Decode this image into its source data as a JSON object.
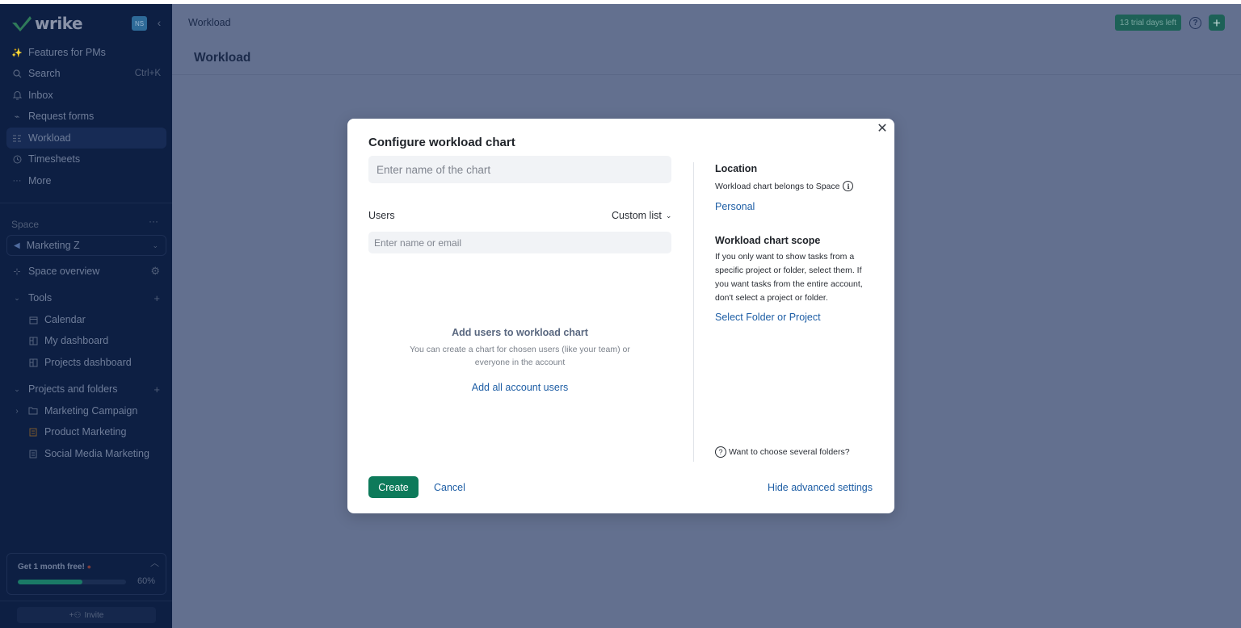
{
  "brand": {
    "name": "wrike",
    "avatar_initials": "NS"
  },
  "sidebar": {
    "nav": [
      {
        "label": "Features for PMs",
        "icon": "sparkle-icon"
      },
      {
        "label": "Search",
        "icon": "search-icon",
        "shortcut": "Ctrl+K"
      },
      {
        "label": "Inbox",
        "icon": "bell-icon"
      },
      {
        "label": "Request forms",
        "icon": "form-icon"
      },
      {
        "label": "Workload",
        "icon": "workload-icon",
        "active": true
      },
      {
        "label": "Timesheets",
        "icon": "clock-icon"
      },
      {
        "label": "More",
        "icon": "more-icon"
      }
    ],
    "space": {
      "label": "Space",
      "more": "···",
      "selected": "Marketing Z",
      "overview": "Space overview"
    },
    "tools": {
      "label": "Tools",
      "items": [
        {
          "label": "Calendar",
          "icon": "calendar-icon"
        },
        {
          "label": "My dashboard",
          "icon": "dashboard-icon"
        },
        {
          "label": "Projects dashboard",
          "icon": "dashboard-icon"
        }
      ]
    },
    "projects": {
      "label": "Projects and folders",
      "items": [
        {
          "label": "Marketing Campaign",
          "icon": "folder-icon"
        },
        {
          "label": "Product Marketing",
          "icon": "project-icon"
        },
        {
          "label": "Social Media Marketing",
          "icon": "project-icon"
        }
      ]
    },
    "promo": {
      "text": "Get 1 month free!",
      "progress": 60,
      "progress_label": "60%"
    },
    "invite": "Invite"
  },
  "header": {
    "breadcrumb": "Workload",
    "trial": "13 trial days left",
    "title": "Workload"
  },
  "modal": {
    "title": "Configure workload chart",
    "name_placeholder": "Enter name of the chart",
    "users_label": "Users",
    "users_mode": "Custom list",
    "email_placeholder": "Enter name or email",
    "empty_title": "Add users to workload chart",
    "empty_desc": "You can create a chart for chosen users (like your team) or everyone in the account",
    "add_all": "Add all account users",
    "location_title": "Location",
    "location_desc": "Workload chart belongs to Space",
    "location_value": "Personal",
    "scope_title": "Workload chart scope",
    "scope_desc": "If you only want to show tasks from a specific project or folder, select them. If you want tasks from the entire account, don't select a project or folder.",
    "select_folder": "Select Folder or Project",
    "several_folders": "Want to choose several folders?",
    "create": "Create",
    "cancel": "Cancel",
    "hide_advanced": "Hide advanced settings"
  },
  "colors": {
    "sidebar_bg": "#0d1f43",
    "overlay_bg": "#63708f",
    "brand_green": "#0d7a5a",
    "link_blue": "#1e5ea5"
  }
}
